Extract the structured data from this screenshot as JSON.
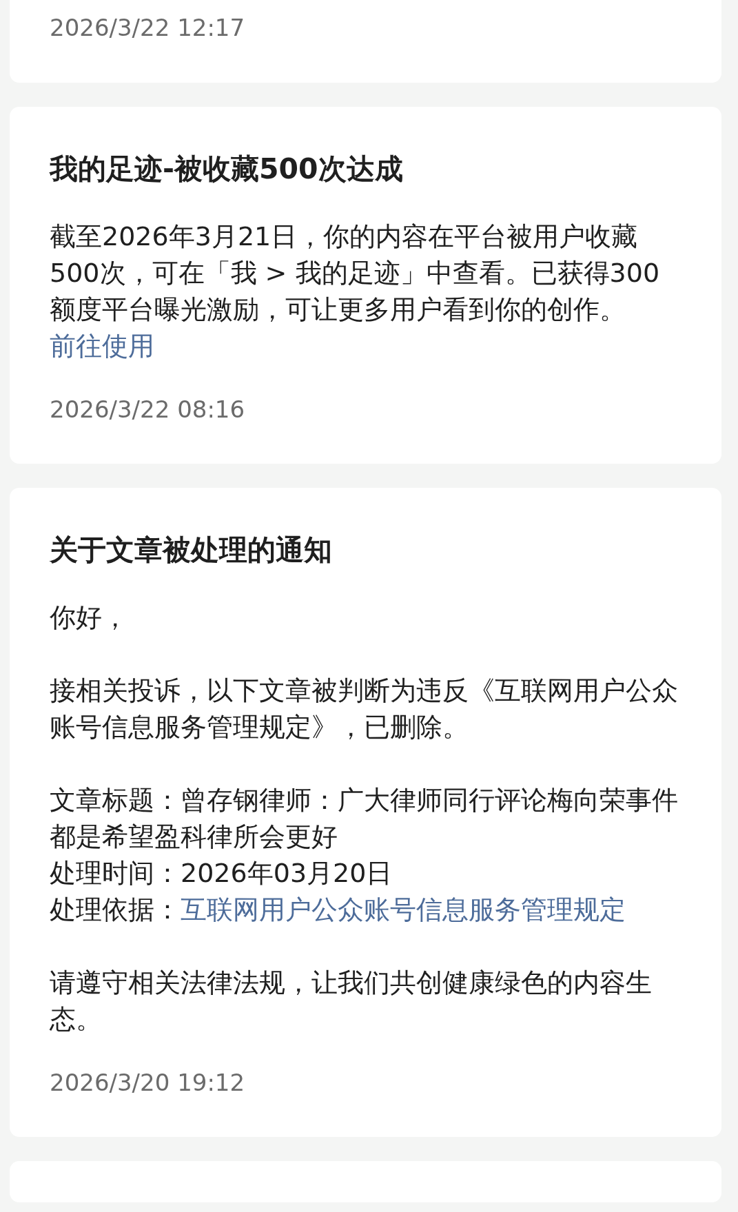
{
  "messages": [
    {
      "cut_top": true,
      "time": "2026/3/22 12:17"
    },
    {
      "cut_top": false,
      "title": "我的足迹-被收藏500次达成",
      "paragraphs": [
        [
          {
            "kind": "text",
            "text": "截至2026年3月21日，你的内容在平台被用户收藏500次，可在「我 > 我的足迹」中查看。已获得300额度平台曝光激励，可让更多用户看到你的创作。"
          },
          {
            "kind": "link",
            "text": "前往使用"
          }
        ]
      ],
      "time": "2026/3/22 08:16"
    },
    {
      "cut_top": false,
      "title": "关于文章被处理的通知",
      "paragraphs": [
        [
          {
            "kind": "text",
            "text": "你好，"
          }
        ],
        [
          {
            "kind": "text",
            "text": "接相关投诉，以下文章被判断为违反《互联网用户公众账号信息服务管理规定》，已删除。"
          }
        ],
        [
          {
            "kind": "text",
            "text": "文章标题：曾存钢律师：广大律师同行评论梅向荣事件都是希望盈科律所会更好"
          },
          {
            "kind": "break"
          },
          {
            "kind": "text",
            "text": "处理时间：2026年03月20日"
          },
          {
            "kind": "break"
          },
          {
            "kind": "text",
            "text": "处理依据："
          },
          {
            "kind": "link",
            "text": "互联网用户公众账号信息服务管理规定"
          }
        ],
        [
          {
            "kind": "text",
            "text": "请遵守相关法律法规，让我们共创健康绿色的内容生态。"
          }
        ]
      ],
      "time": "2026/3/20 19:12"
    }
  ]
}
